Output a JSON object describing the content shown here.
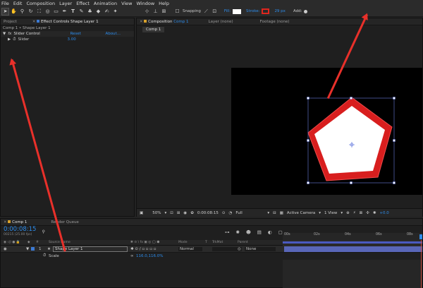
{
  "menu": [
    "File",
    "Edit",
    "Composition",
    "Layer",
    "Effect",
    "Animation",
    "View",
    "Window",
    "Help"
  ],
  "toolbar": {
    "tools": [
      "selection-tool",
      "hand-tool",
      "zoom-tool",
      "rotate-tool",
      "camera-tool",
      "pan-behind-tool",
      "rectangle-tool",
      "pen-tool",
      "type-tool",
      "brush-tool",
      "clone-stamp-tool",
      "eraser-tool",
      "roto-brush-tool",
      "puppet-tool"
    ],
    "snapping_label": "Snapping",
    "fill_label": "Fill:",
    "fill_color": "#ffffff",
    "stroke_label": "Stroke:",
    "stroke_color": "#e0261e",
    "stroke_width": "29 px",
    "add_label": "Add:"
  },
  "left_panel": {
    "tabs": [
      "Project",
      "Effect Controls Shape Layer 1"
    ],
    "breadcrumb": "Comp 1 • Shape Layer 1",
    "effect_name": "Slider Control",
    "reset_label": "Reset",
    "about_label": "About...",
    "param_name": "Slider",
    "param_value": "3.00"
  },
  "comp_panel": {
    "tab_label": "Composition",
    "comp_name": "Comp 1",
    "layer_tab": "Layer (none)",
    "footage_tab": "Footage (none)",
    "sub_tab": "Comp 1",
    "bottom": {
      "zoom": "50%",
      "timecode": "0:00:08:15",
      "resolution": "Full",
      "camera": "Active Camera",
      "views": "1 View",
      "exposure": "+0.0"
    }
  },
  "timeline": {
    "tab_label": "Comp 1",
    "render_queue": "Render Queue",
    "timecode": "0:00:08:15",
    "frame_info": "00215 (25.00 fps)",
    "columns": {
      "source_name": "Source Name",
      "mode": "Mode",
      "t": "T",
      "trkmat": "TrkMat",
      "parent": "Parent"
    },
    "layer_number": "1",
    "layer_name": "Shape Layer 1",
    "layer_mode": "Normal",
    "layer_parent": "None",
    "scale_label": "Scale",
    "scale_value": "116.0,116.0%",
    "ruler": [
      "00s",
      "02s",
      "04s",
      "06s",
      "08s"
    ]
  }
}
